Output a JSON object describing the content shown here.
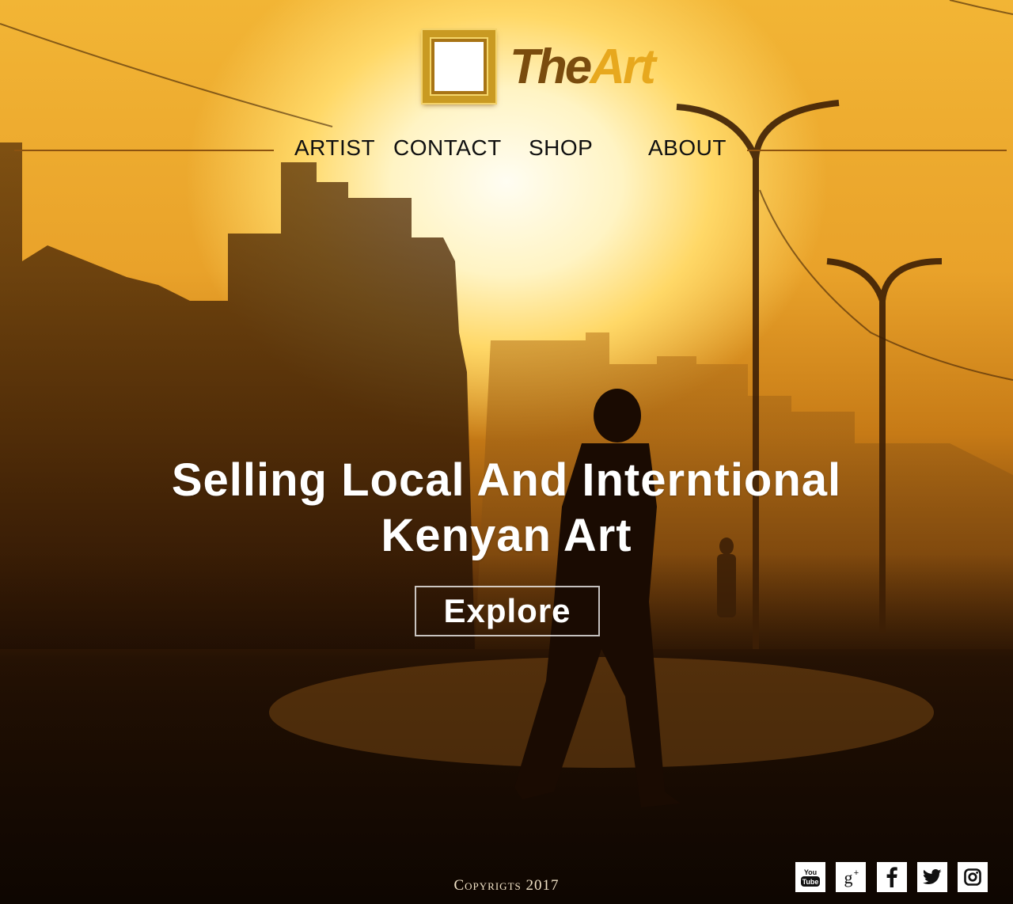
{
  "brand": {
    "name_part1": "The",
    "name_part2": "Art"
  },
  "nav": {
    "items": [
      {
        "label": "ARTIST"
      },
      {
        "label": "CONTACT"
      },
      {
        "label": "SHOP"
      },
      {
        "label": "ABOUT"
      }
    ]
  },
  "hero": {
    "title_line1": "Selling Local And Interntional",
    "title_line2": "Kenyan Art",
    "cta_label": "Explore"
  },
  "footer": {
    "copyright": "Copyrigts 2017",
    "social": [
      {
        "icon": "youtube-icon",
        "label": "You Tube"
      },
      {
        "icon": "google-plus-icon",
        "label": "g+"
      },
      {
        "icon": "facebook-icon",
        "label": "f"
      },
      {
        "icon": "twitter-icon",
        "label": ""
      },
      {
        "icon": "instagram-icon",
        "label": ""
      }
    ]
  },
  "colors": {
    "brand_dark": "#7a4c0e",
    "brand_gold": "#e7a81e",
    "nav_line": "#8c5310",
    "hero_text": "#ffffff"
  }
}
